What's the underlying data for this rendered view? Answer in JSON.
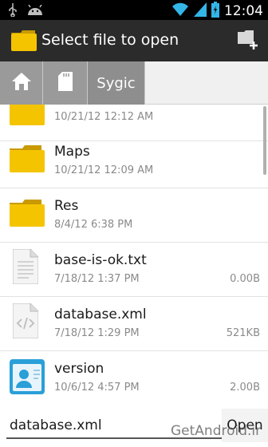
{
  "status": {
    "time": "12:04"
  },
  "actionbar": {
    "title": "Select file to open"
  },
  "breadcrumb": {
    "current": "Sygic"
  },
  "files": [
    {
      "name": "",
      "date": "10/21/12 12:12 AM",
      "size": "",
      "kind": "folder"
    },
    {
      "name": "Maps",
      "date": "10/21/12 12:09 AM",
      "size": "",
      "kind": "folder"
    },
    {
      "name": "Res",
      "date": "8/4/12 6:38 PM",
      "size": "",
      "kind": "folder"
    },
    {
      "name": "base-is-ok.txt",
      "date": "7/18/12 1:37 PM",
      "size": "0.00B",
      "kind": "text"
    },
    {
      "name": "database.xml",
      "date": "7/18/12 1:29 PM",
      "size": "521KB",
      "kind": "xml"
    },
    {
      "name": "version",
      "date": "10/6/12 4:57 PM",
      "size": "2.00B",
      "kind": "contact"
    }
  ],
  "bottom": {
    "filename": "database.xml",
    "open_label": "Open",
    "watermark": "GetAndroid.ir"
  }
}
